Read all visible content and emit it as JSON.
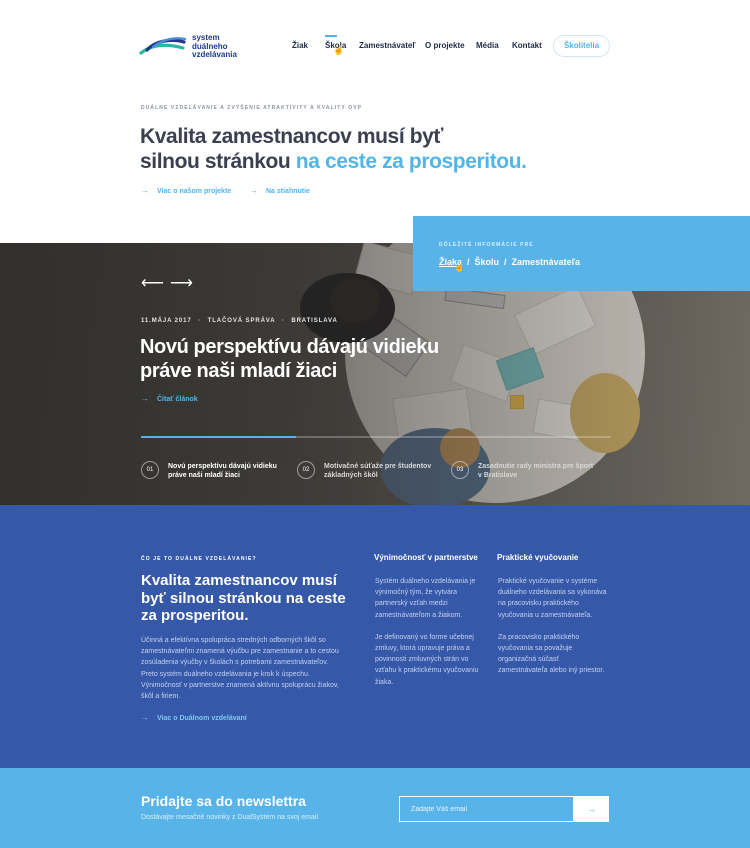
{
  "header": {
    "logo": {
      "line1": "system",
      "line2": "duálneho",
      "line3": "vzdelávania"
    },
    "nav": [
      {
        "label": "Žiak"
      },
      {
        "label": "Škola"
      },
      {
        "label": "Zamestnávateľ"
      },
      {
        "label": "O projekte"
      },
      {
        "label": "Média"
      },
      {
        "label": "Kontakt"
      }
    ],
    "active_nav": "Škola",
    "cta_label": "Školitelia"
  },
  "intro": {
    "eyebrow": "Duálne vzdelávanie a zvýšenie atraktivity a kvality OVP",
    "title_line1": "Kvalita zamestnancov musí byť",
    "title_line2_start": "silnou stránkou",
    "title_line2_accent": "na ceste za prosperitou.",
    "links": [
      {
        "label": "Viac o našom projekte"
      },
      {
        "label": "Na stiahnutie"
      }
    ]
  },
  "info_box": {
    "eyebrow": "Dôležité informácie pre",
    "links": [
      {
        "label": "Žiaka"
      },
      {
        "label": "Školu"
      },
      {
        "label": "Zamestnávateľa"
      }
    ],
    "separator": "/"
  },
  "hero": {
    "arrows": "⟵ ⟶",
    "date": "11.mája 2017",
    "category": "Tlačová správa",
    "location": "Bratislava",
    "dot": "·",
    "heading": "Novú perspektívu dávajú vidieku práve naši mladí žiaci",
    "link_label": "Čítať článok",
    "progress": 0.33,
    "slides": [
      {
        "num": "01",
        "text": "Novú perspektívu dávajú vidieku práve naši mladí žiaci"
      },
      {
        "num": "02",
        "text": "Motivačné súťaže pre študentov základných škôl"
      },
      {
        "num": "03",
        "text": "Zasadnutie rady ministra pre šport v Bratislave"
      }
    ]
  },
  "about": {
    "eyebrow": "Čo je to duálne vzdelávanie?",
    "title": "Kvalita zamestnancov musí byť silnou stránkou na ceste za prosperitou.",
    "body": "Účinná a efektívna spolupráca stredných odborných škôl so zamestnávateľmi znamená výučbu pre zamestnanie a to cestou zosúladenia výučby v školách s potrebami zamestnávateľov. Preto systém duálneho vzdelávania je krok k úspechu. Výnimočnosť v partnerstve znamená aktívnu spoluprácu žiakov, škôl a firiem.",
    "link_label": "Viac o Duálnom vzdelávaní",
    "columns": [
      {
        "heading": "Výnimočnosť v partnerstve",
        "paragraphs": [
          "Systém duálneho vzdelávania je výnimočný tým, že vytvára partnerský vzťah medzi zamestnávateľom a žiakom.",
          "Je definovaný vo forme učebnej zmluvy, ktorá upravuje práva a povinnosti zmluvných strán vo vzťahu k praktickému vyučovaniu žiaka."
        ]
      },
      {
        "heading": "Praktické vyučovanie",
        "paragraphs": [
          "Praktické vyučovanie v systéme duálneho vzdelávania sa vykonáva na pracovisku praktického vyučovania u zamestnávateľa.",
          "Za pracovisko praktického vyučovania sa považuje organizačná súčasť zamestnávateľa alebo iný priestor."
        ]
      }
    ]
  },
  "newsletter": {
    "title": "Pridajte sa do newslettra",
    "subtitle": "Dostávajte mesačné novinky z DualSystem na svoj email",
    "input_placeholder": "Zadajte Váš email",
    "submit_icon": "arrow-right-icon"
  },
  "colors": {
    "accent": "#52b5e9",
    "navy": "#3658a8",
    "light_blue": "#58b3e8",
    "text_dark": "#3a4050"
  }
}
